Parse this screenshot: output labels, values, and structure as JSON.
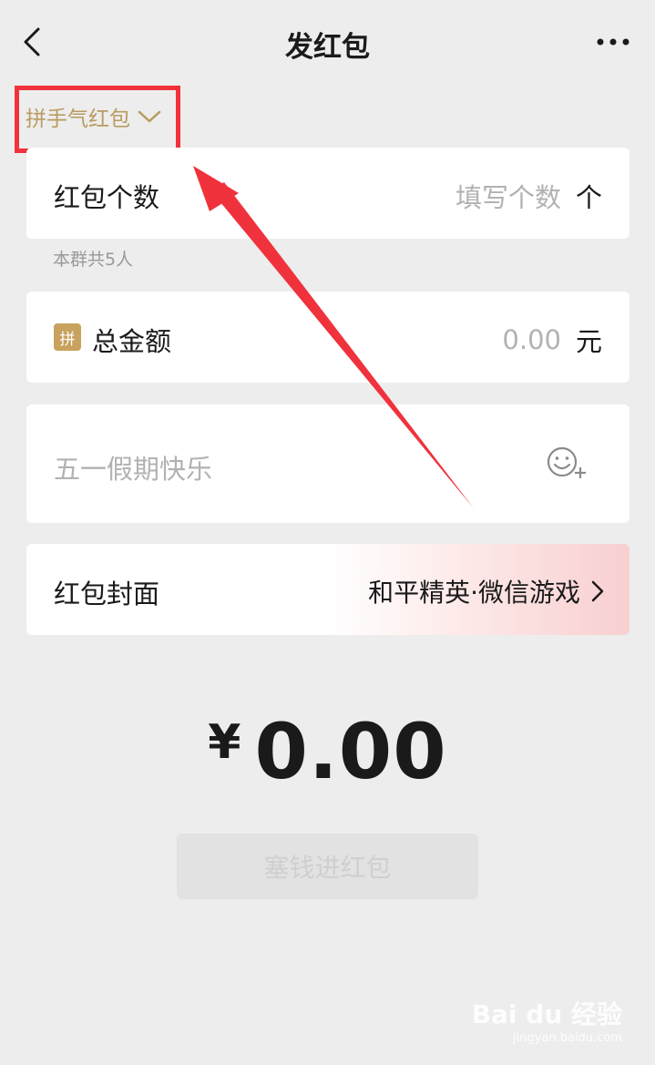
{
  "nav": {
    "title": "发红包"
  },
  "packet_type": {
    "label": "拼手气红包"
  },
  "count_row": {
    "label": "红包个数",
    "placeholder": "填写个数",
    "unit": "个",
    "hint": "本群共5人"
  },
  "amount_row": {
    "badge": "拼",
    "label": "总金额",
    "placeholder": "0.00",
    "unit": "元"
  },
  "message_row": {
    "placeholder": "五一假期快乐"
  },
  "cover_row": {
    "label": "红包封面",
    "value": "和平精英·微信游戏"
  },
  "total": {
    "currency": "¥",
    "value": "0.00"
  },
  "submit": {
    "label": "塞钱进红包"
  },
  "watermark": {
    "main": "Bai du 经验",
    "sub": "jingyan.baidu.com"
  },
  "colors": {
    "accent_gold": "#b99b60",
    "annotation_red": "#f0323c",
    "background": "#ededed"
  }
}
